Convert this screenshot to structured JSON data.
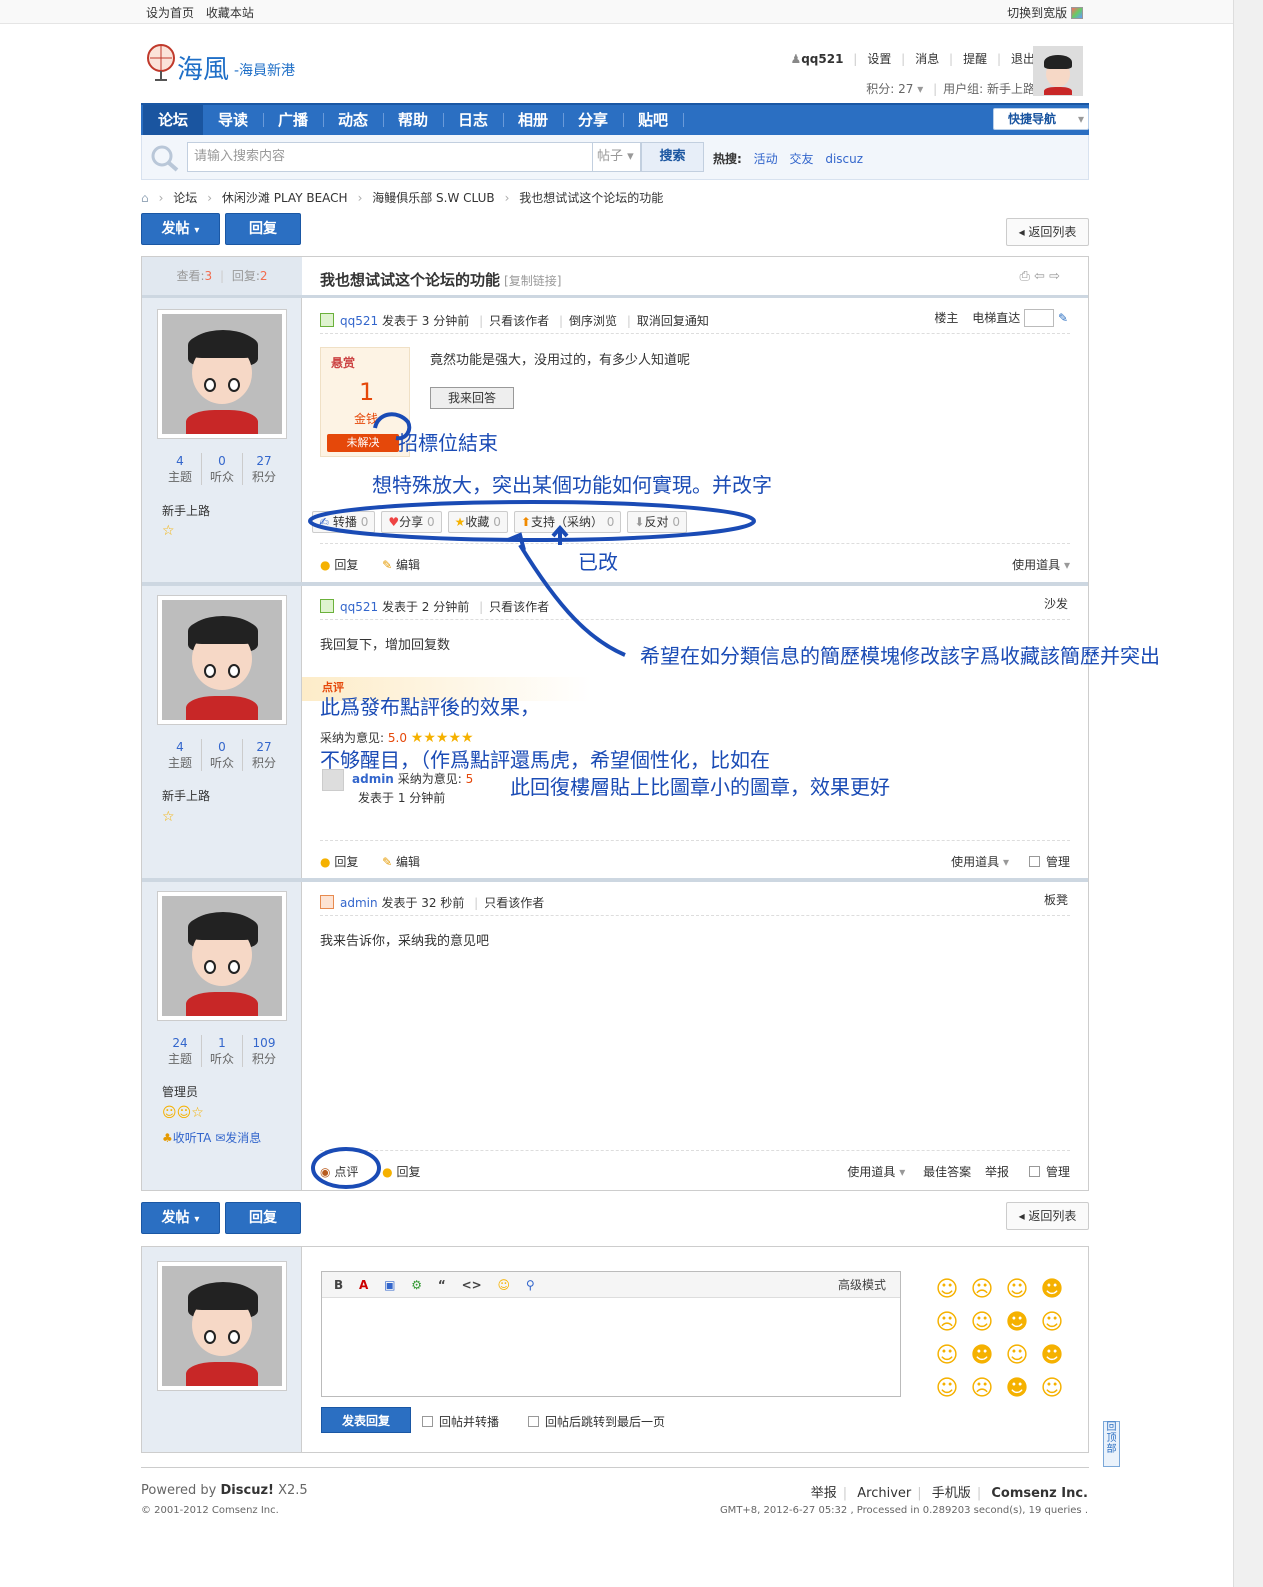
{
  "topbar": {
    "set_home": "设为首页",
    "bookmark": "收藏本站",
    "switch_wide": "切换到宽版"
  },
  "logo": {
    "brand": "海風",
    "sub": "-海員新港"
  },
  "user": {
    "name": "qq521",
    "links": [
      "设置",
      "消息",
      "提醒",
      "退出"
    ],
    "points": "积分: 27",
    "group": "用户组: 新手上路"
  },
  "nav": {
    "items": [
      "论坛",
      "导读",
      "广播",
      "动态",
      "帮助",
      "日志",
      "相册",
      "分享",
      "贴吧"
    ],
    "quick": "快捷导航"
  },
  "search": {
    "placeholder": "请输入搜索内容",
    "type": "帖子",
    "button": "搜索",
    "hot_label": "热搜:",
    "hot": [
      "活动",
      "交友",
      "discuz"
    ]
  },
  "breadcrumb": [
    "论坛",
    "休闲沙滩 PLAY BEACH",
    "海鳗俱乐部 S.W CLUB",
    "我也想试试这个论坛的功能"
  ],
  "buttons": {
    "post": "发帖",
    "reply": "回复",
    "back": "返回列表"
  },
  "thread": {
    "views_label": "查看:",
    "views": "3",
    "replies_label": "回复:",
    "replies": "2",
    "title": "我也想试试这个论坛的功能",
    "copy_link": "[复制链接]"
  },
  "posts": [
    {
      "stats": [
        {
          "n": "4",
          "l": "主题"
        },
        {
          "n": "0",
          "l": "听众"
        },
        {
          "n": "27",
          "l": "积分"
        }
      ],
      "group": "新手上路",
      "author": "qq521",
      "time": "发表于 3 分钟前",
      "links": [
        "只看该作者",
        "倒序浏览",
        "取消回复通知"
      ],
      "floor": "楼主",
      "jump": "电梯直达",
      "reward": {
        "label": "悬赏",
        "amount": "1",
        "unit": "金钱",
        "status": "未解决"
      },
      "content": "竟然功能是强大，没用过的，有多少人知道呢",
      "answer_btn": "我来回答",
      "actions": [
        {
          "l": "转播",
          "c": "0"
        },
        {
          "l": "分享",
          "c": "0"
        },
        {
          "l": "收藏",
          "c": "0"
        },
        {
          "l": "支持（采纳）",
          "c": "0"
        },
        {
          "l": "反对",
          "c": "0"
        }
      ],
      "foot": [
        "回复",
        "编辑"
      ],
      "tools": "使用道具"
    },
    {
      "stats": [
        {
          "n": "4",
          "l": "主题"
        },
        {
          "n": "0",
          "l": "听众"
        },
        {
          "n": "27",
          "l": "积分"
        }
      ],
      "group": "新手上路",
      "author": "qq521",
      "time": "发表于 2 分钟前",
      "links": [
        "只看该作者"
      ],
      "floor": "沙发",
      "content": "我回复下，增加回复数",
      "rate_tag": "点评",
      "rate_line": "采纳为意见:",
      "rate_score": "5.0",
      "rater": "admin",
      "rater_text": "采纳为意见:",
      "rater_score": "5",
      "rater_time": "发表于 1 分钟前",
      "foot": [
        "回复",
        "编辑"
      ],
      "tools": "使用道具",
      "manage": "管理"
    },
    {
      "stats": [
        {
          "n": "24",
          "l": "主题"
        },
        {
          "n": "1",
          "l": "听众"
        },
        {
          "n": "109",
          "l": "积分"
        }
      ],
      "group": "管理员",
      "follow": "收听TA",
      "message": "发消息",
      "author": "admin",
      "time": "发表于 32 秒前",
      "links": [
        "只看该作者"
      ],
      "floor": "板凳",
      "content": "我来告诉你，采纳我的意见吧",
      "foot": [
        "点评",
        "回复"
      ],
      "tools": "使用道具",
      "best": "最佳答案",
      "report": "举报",
      "manage": "管理"
    }
  ],
  "annotations": {
    "a1": "招標位結束",
    "a2": "想特殊放大，突出某個功能如何實現。并改字",
    "a3": "已改",
    "a4": "希望在如分類信息的簡歷模塊修改該字爲收藏該簡歷并突出",
    "a5": "此爲發布點評後的效果，",
    "a6": "不够醒目，（作爲點評還馬虎，希望個性化，比如在",
    "a7": "此回復樓層貼上比圖章小的圖章，效果更好"
  },
  "editor": {
    "mode": "高级模式",
    "submit": "发表回复",
    "opt1": "回帖并转播",
    "opt2": "回帖后跳转到最后一页"
  },
  "footer": {
    "powered": "Powered by",
    "brand": "Discuz!",
    "version": "X2.5",
    "copyright": "© 2001-2012 Comsenz Inc.",
    "links": [
      "举报",
      "Archiver",
      "手机版"
    ],
    "company": "Comsenz Inc.",
    "stats": "GMT+8, 2012-6-27 05:32 , Processed in 0.289203 second(s), 19 queries ."
  },
  "totop": "回顶部",
  "colors": {
    "nav": "#2b6fc2",
    "annotation": "#1a4bb5",
    "accent": "#e5480a"
  }
}
